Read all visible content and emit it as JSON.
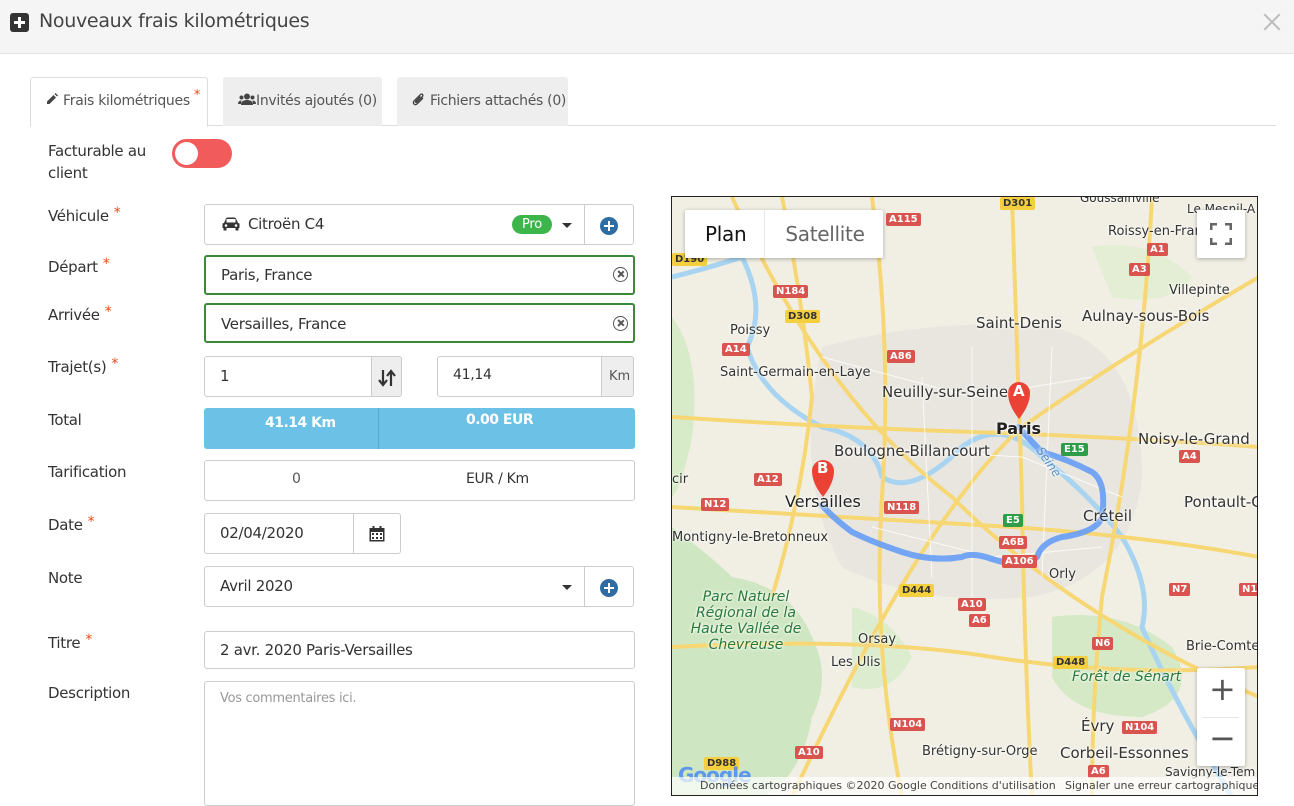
{
  "header": {
    "title": "Nouveaux frais kilométriques"
  },
  "tabs": [
    {
      "label": "Frais kilométriques",
      "required": "*"
    },
    {
      "label": "Invités ajoutés (0)"
    },
    {
      "label": "Fichiers attachés (0)"
    }
  ],
  "form": {
    "billable_label": "Facturable au client",
    "vehicle_label": "Véhicule",
    "vehicle_value": "Citroën C4",
    "vehicle_badge": "Pro",
    "departure_label": "Départ",
    "departure_value": "Paris, France",
    "arrival_label": "Arrivée",
    "arrival_value": "Versailles, France",
    "trips_label": "Trajet(s)",
    "trips_value": "1",
    "distance_value": "41,14",
    "distance_unit": "Km",
    "total_label": "Total",
    "total_km": "41.14 Km",
    "total_eur": "0.00 EUR",
    "pricing_label": "Tarification",
    "pricing_value": "0",
    "pricing_unit": "EUR / Km",
    "date_label": "Date",
    "date_value": "02/04/2020",
    "note_label": "Note",
    "note_value": "Avril 2020",
    "title_label": "Titre",
    "title_value": "2 avr. 2020 Paris-Versailles",
    "description_label": "Description",
    "description_placeholder": "Vos commentaires ici.",
    "required_star": "*"
  },
  "map": {
    "type_plan": "Plan",
    "type_satellite": "Satellite",
    "zoom_in": "+",
    "zoom_out": "−",
    "marker_a": "A",
    "marker_b": "B",
    "footer_data": "Données cartographiques ©2020 Google",
    "footer_terms": "Conditions d'utilisation",
    "footer_report": "Signaler une erreur cartographique",
    "google": "Google",
    "places": {
      "paris": "Paris",
      "versailles": "Versailles",
      "saint_denis": "Saint-Denis",
      "aulnay": "Aulnay-sous-Bois",
      "neuilly": "Neuilly-sur-Seine",
      "boulogne": "Boulogne-Billancourt",
      "noisy": "Noisy-le-Grand",
      "creteil": "Créteil",
      "pontault": "Pontault-Co",
      "poissy": "Poissy",
      "sgel": "Saint-Germain-en-Laye",
      "montigny": "Montigny-le-Bretonneux",
      "orly": "Orly",
      "orsay": "Orsay",
      "les_ulis": "Les Ulis",
      "evry": "Évry",
      "bretigny": "Brétigny-sur-Orge",
      "corbeil": "Corbeil-Essonnes",
      "brie": "Brie-Comte",
      "roissy": "Roissy-en-Fran",
      "villepinte": "Villepinte",
      "mesnil": "Le Mesnil-A",
      "savigny": "Savigny-le-Tem",
      "goussainville": "Goussainville",
      "cir": "cir",
      "parc": "Parc Naturel Régional de la Haute Vallée de Chevreuse",
      "senart": "Forêt de Sénart",
      "seine": "Seine"
    },
    "roads": [
      "A115",
      "D301",
      "A1",
      "A3",
      "D190",
      "N184",
      "D308",
      "A14",
      "A86",
      "A12",
      "N12",
      "N118",
      "E15",
      "A4",
      "E5",
      "A6B",
      "A106",
      "D444",
      "A10",
      "A6",
      "N6",
      "D448",
      "N104",
      "N7",
      "D988",
      "N104",
      "A10",
      "A6",
      "N104"
    ]
  },
  "colors": {
    "toggle": "#f25b5b",
    "green_border": "#3a8a3a",
    "badge_green": "#3cb54a",
    "total_blue": "#6bc1e6",
    "plus_blue": "#2e6da4",
    "required_red": "#e8491d"
  }
}
